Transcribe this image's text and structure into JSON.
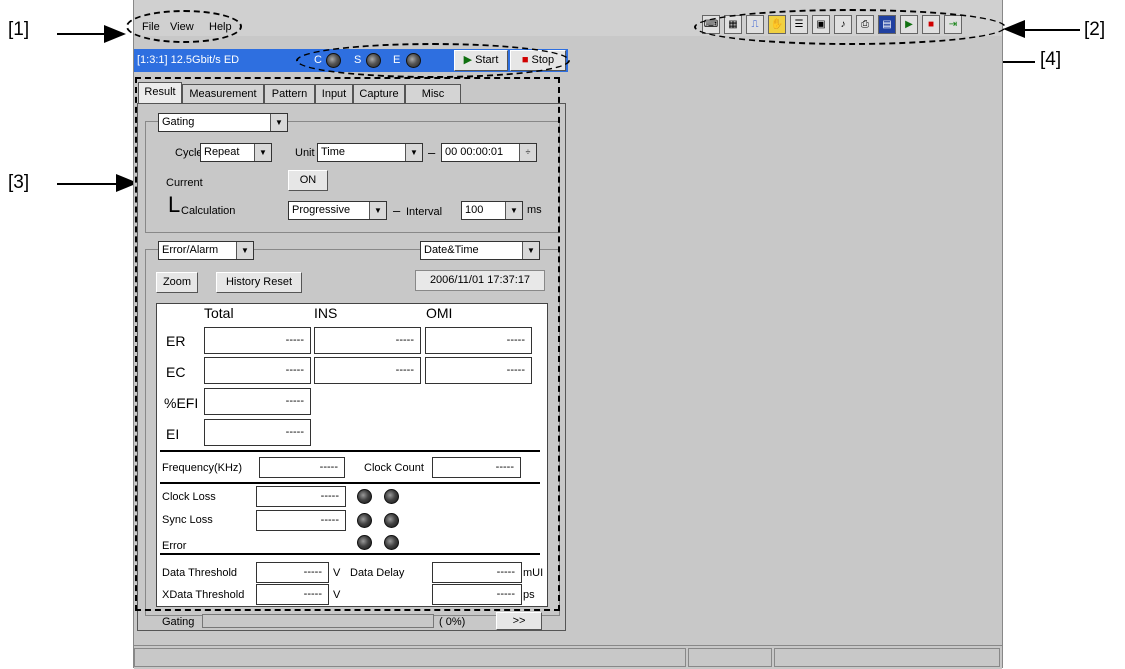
{
  "callouts": {
    "c1": "[1]",
    "c2": "[2]",
    "c3": "[3]",
    "c4": "[4]"
  },
  "menu": {
    "file": "File",
    "view": "View",
    "help": "Help"
  },
  "toolbar": {
    "icons": [
      "keyboard-icon",
      "calendar-icon",
      "pulse-icon",
      "hand-icon",
      "panel-icon",
      "save-icon",
      "sound-icon",
      "print-icon",
      "calc-icon",
      "play-icon",
      "stop-icon",
      "exit-icon"
    ]
  },
  "status": {
    "device": "[1:3:1] 12.5Gbit/s ED",
    "c": "C",
    "s": "S",
    "e": "E",
    "start": "Start",
    "stop": "Stop"
  },
  "tabs": [
    "Result",
    "Measurement",
    "Pattern",
    "Input",
    "Capture",
    "Misc"
  ],
  "gating": {
    "mode": "Gating",
    "cycle_label": "Cycle",
    "cycle": "Repeat",
    "unit_label": "Unit",
    "unit": "Time",
    "dash1": "–",
    "time": "00 00:00:01",
    "current_label": "Current",
    "current_state": "ON",
    "calc_label": "Calculation",
    "calc_mark": "L",
    "calc": "Progressive",
    "dash2": "–",
    "interval_label": "Interval",
    "interval": "100",
    "ms": "ms"
  },
  "results": {
    "type": "Error/Alarm",
    "date_mode": "Date&Time",
    "zoom": "Zoom",
    "history_reset": "History Reset",
    "datetime": "2006/11/01 17:37:17",
    "cols": [
      "Total",
      "INS",
      "OMI"
    ],
    "rows": [
      "ER",
      "EC",
      "%EFI",
      "EI"
    ],
    "blank": "-----",
    "freq_label": "Frequency(KHz)",
    "clock_count_label": "Clock Count",
    "clock_loss": "Clock Loss",
    "sync_loss": "Sync Loss",
    "error": "Error",
    "data_threshold": "Data Threshold",
    "xdata_threshold": "XData Threshold",
    "data_delay": "Data Delay",
    "v": "V",
    "mui": "mUI",
    "ps": "ps"
  },
  "footer": {
    "gating": "Gating",
    "pct": "(   0%)",
    "more": ">>"
  }
}
